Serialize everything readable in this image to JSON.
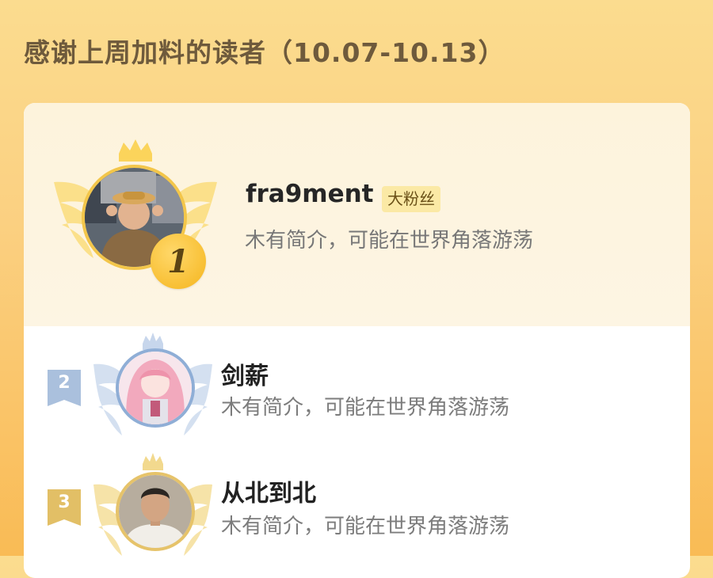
{
  "page": {
    "title": "感谢上周加料的读者（10.07-10.13）"
  },
  "colors": {
    "background_top": "#fbdc8f",
    "background_bottom": "#f9bb55",
    "gold": "#f5b51d",
    "silver_blue": "#8faed6",
    "bronze": "#e6c36a"
  },
  "readers": [
    {
      "rank": "1",
      "name": "fra9ment",
      "badge": "大粉丝",
      "bio": "木有简介，可能在世界角落游荡",
      "avatar_icon": "child-photo-avatar"
    },
    {
      "rank": "2",
      "name": "剑薪",
      "bio": "木有简介，可能在世界角落游荡",
      "avatar_icon": "anime-girl-avatar"
    },
    {
      "rank": "3",
      "name": "从北到北",
      "bio": "木有简介，可能在世界角落游荡",
      "avatar_icon": "man-photo-avatar"
    }
  ]
}
